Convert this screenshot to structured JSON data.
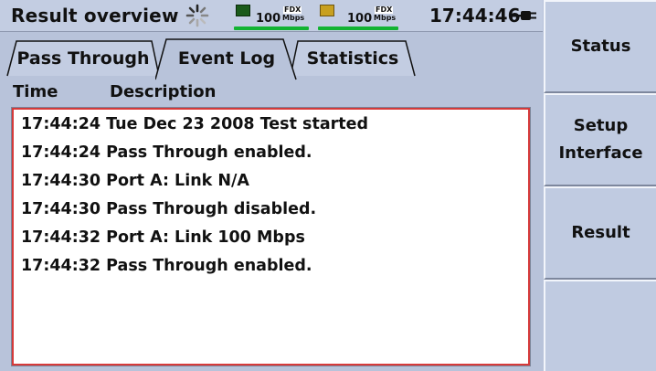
{
  "title": "Result overview",
  "status": {
    "port_a": {
      "speed": "100",
      "duplex": "FDX",
      "unit": "Mbps"
    },
    "port_b": {
      "speed": "100",
      "duplex": "FDX",
      "unit": "Mbps"
    },
    "time": "17:44:46",
    "colors": {
      "link_ok": "#12b332",
      "log_border": "#d63a3a"
    }
  },
  "tabs": [
    {
      "label": "Pass Through"
    },
    {
      "label": "Event Log",
      "active": true
    },
    {
      "label": "Statistics"
    }
  ],
  "columns": {
    "time": "Time",
    "description": "Description"
  },
  "log": [
    "17:44:24 Tue Dec 23 2008 Test started",
    "17:44:24 Pass Through enabled.",
    "17:44:30 Port A: Link N/A",
    "17:44:30 Pass Through disabled.",
    "17:44:32 Port A: Link 100 Mbps",
    "17:44:32 Pass Through enabled."
  ],
  "side_buttons": [
    {
      "label": "Status"
    },
    {
      "label": "Setup\nInterface"
    },
    {
      "label": "Result"
    },
    {
      "label": ""
    }
  ]
}
